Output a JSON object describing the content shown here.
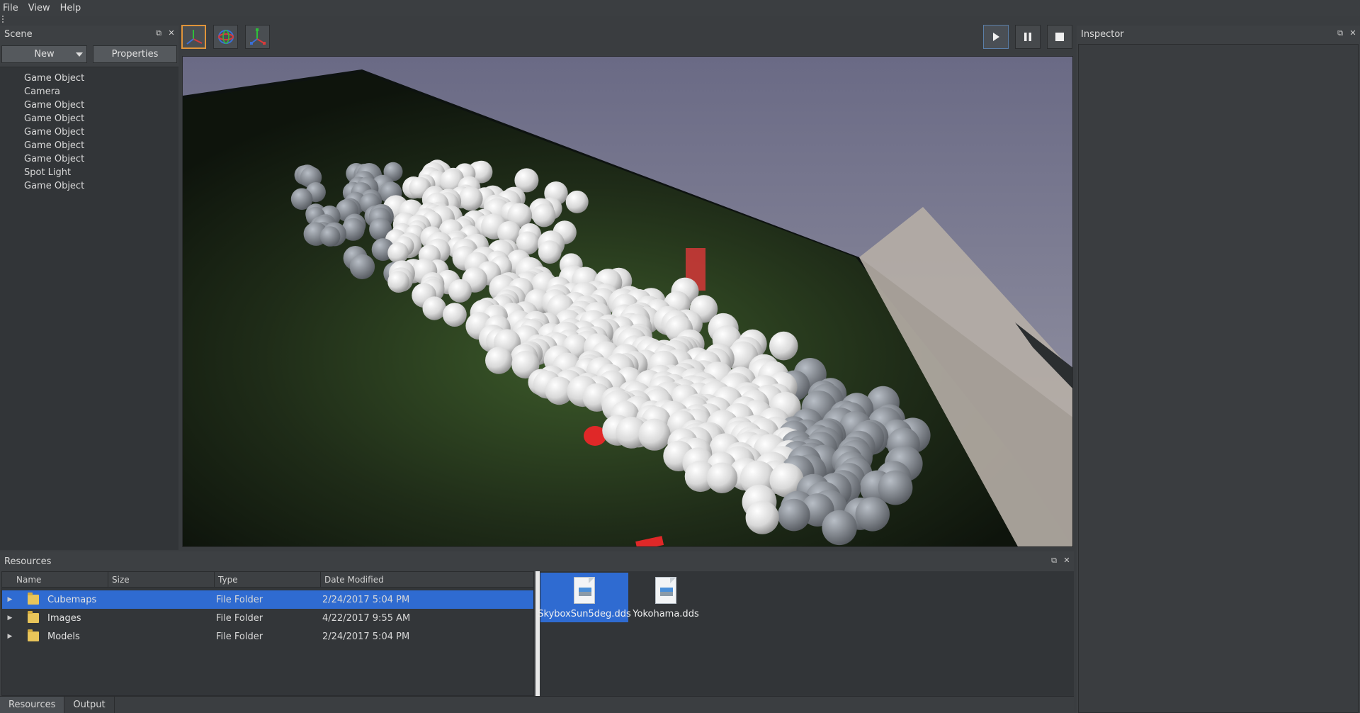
{
  "menu": [
    "File",
    "View",
    "Help"
  ],
  "scene": {
    "title": "Scene",
    "new_label": "New",
    "properties_label": "Properties",
    "items": [
      "Game Object",
      "Camera",
      "Game Object",
      "Game Object",
      "Game Object",
      "Game Object",
      "Game Object",
      "Spot Light",
      "Game Object"
    ]
  },
  "toolbar": {
    "tools": [
      "translate-gizmo-icon",
      "rotate-gizmo-icon",
      "scale-gizmo-icon"
    ],
    "playback": [
      "play-icon",
      "pause-icon",
      "stop-icon"
    ]
  },
  "inspector": {
    "title": "Inspector"
  },
  "resources": {
    "title": "Resources",
    "columns": [
      "Name",
      "Size",
      "Type",
      "Date Modified"
    ],
    "rows": [
      {
        "name": "Cubemaps",
        "size": "",
        "type": "File Folder",
        "date": "2/24/2017 5:04 PM"
      },
      {
        "name": "Images",
        "size": "",
        "type": "File Folder",
        "date": "4/22/2017 9:55 AM"
      },
      {
        "name": "Models",
        "size": "",
        "type": "File Folder",
        "date": "2/24/2017 5:04 PM"
      }
    ],
    "files": [
      "SkyboxSun5deg.dds",
      "Yokohama.dds"
    ]
  },
  "bottom_tabs": [
    "Resources",
    "Output"
  ],
  "colors": {
    "accent": "#2f6bd1",
    "active_tool": "#e0943a",
    "panel_bg": "#3d4043"
  }
}
